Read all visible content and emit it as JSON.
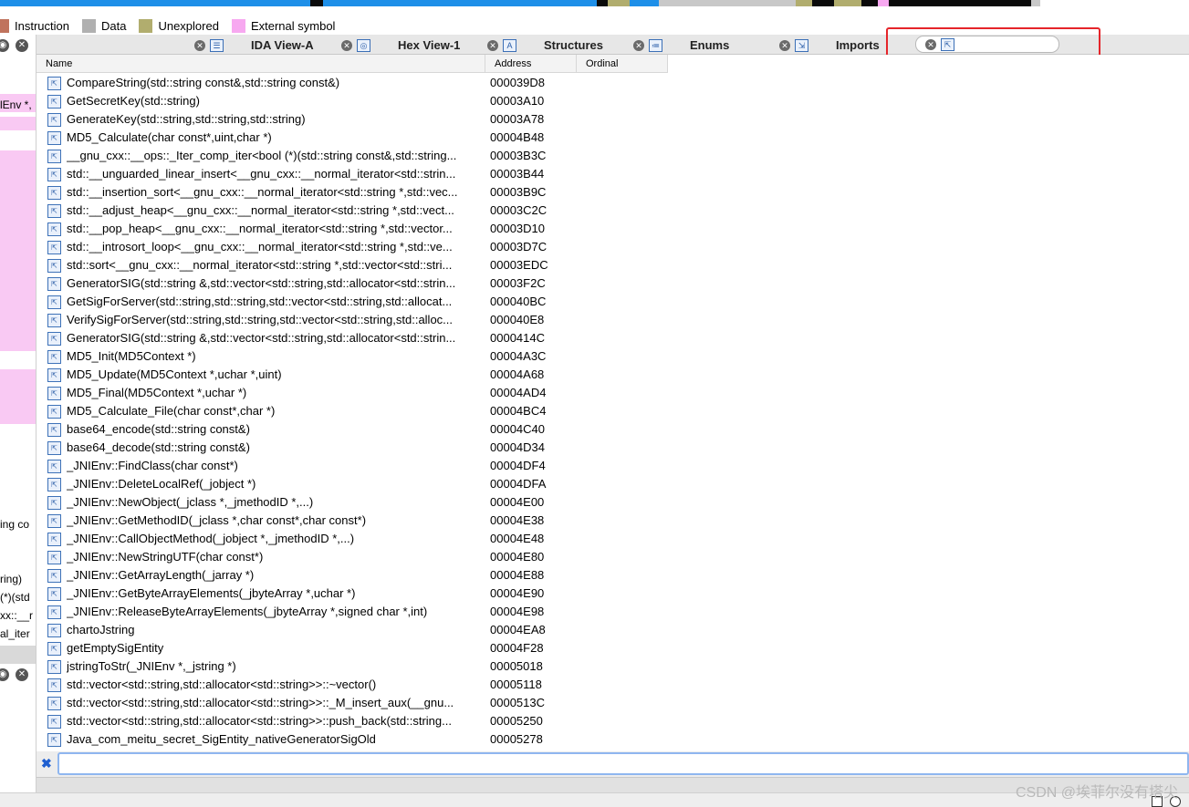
{
  "legend": [
    {
      "label": "Instruction",
      "color": "#c0735d"
    },
    {
      "label": "Data",
      "color": "#b0b0b0"
    },
    {
      "label": "Unexplored",
      "color": "#b1ad6e"
    },
    {
      "label": "External symbol",
      "color": "#f7a8f0"
    }
  ],
  "tabs": [
    {
      "label": "IDA View-A",
      "icon": "disassembly-icon"
    },
    {
      "label": "Hex View-1",
      "icon": "hex-view-icon"
    },
    {
      "label": "Structures",
      "icon": "structures-icon"
    },
    {
      "label": "Enums",
      "icon": "enums-icon"
    },
    {
      "label": "Imports",
      "icon": "imports-icon"
    },
    {
      "label": "",
      "icon": "exports-icon",
      "active": true
    }
  ],
  "table": {
    "columns": [
      "Name",
      "Address",
      "Ordinal"
    ],
    "rows": [
      {
        "name": "CompareString(std::string const&,std::string const&)",
        "address": "000039D8"
      },
      {
        "name": "GetSecretKey(std::string)",
        "address": "00003A10"
      },
      {
        "name": "GenerateKey(std::string,std::string,std::string)",
        "address": "00003A78"
      },
      {
        "name": "MD5_Calculate(char const*,uint,char *)",
        "address": "00004B48"
      },
      {
        "name": "__gnu_cxx::__ops::_Iter_comp_iter<bool (*)(std::string const&,std::string...",
        "address": "00003B3C"
      },
      {
        "name": "std::__unguarded_linear_insert<__gnu_cxx::__normal_iterator<std::strin...",
        "address": "00003B44"
      },
      {
        "name": "std::__insertion_sort<__gnu_cxx::__normal_iterator<std::string *,std::vec...",
        "address": "00003B9C"
      },
      {
        "name": "std::__adjust_heap<__gnu_cxx::__normal_iterator<std::string *,std::vect...",
        "address": "00003C2C"
      },
      {
        "name": "std::__pop_heap<__gnu_cxx::__normal_iterator<std::string *,std::vector...",
        "address": "00003D10"
      },
      {
        "name": "std::__introsort_loop<__gnu_cxx::__normal_iterator<std::string *,std::ve...",
        "address": "00003D7C"
      },
      {
        "name": "std::sort<__gnu_cxx::__normal_iterator<std::string *,std::vector<std::stri...",
        "address": "00003EDC"
      },
      {
        "name": "GeneratorSIG(std::string &,std::vector<std::string,std::allocator<std::strin...",
        "address": "00003F2C"
      },
      {
        "name": "GetSigForServer(std::string,std::string,std::vector<std::string,std::allocat...",
        "address": "000040BC"
      },
      {
        "name": "VerifySigForServer(std::string,std::string,std::vector<std::string,std::alloc...",
        "address": "000040E8"
      },
      {
        "name": "GeneratorSIG(std::string &,std::vector<std::string,std::allocator<std::strin...",
        "address": "0000414C"
      },
      {
        "name": "MD5_Init(MD5Context *)",
        "address": "00004A3C"
      },
      {
        "name": "MD5_Update(MD5Context *,uchar *,uint)",
        "address": "00004A68"
      },
      {
        "name": "MD5_Final(MD5Context *,uchar *)",
        "address": "00004AD4"
      },
      {
        "name": "MD5_Calculate_File(char const*,char *)",
        "address": "00004BC4"
      },
      {
        "name": "base64_encode(std::string const&)",
        "address": "00004C40"
      },
      {
        "name": "base64_decode(std::string const&)",
        "address": "00004D34"
      },
      {
        "name": "_JNIEnv::FindClass(char const*)",
        "address": "00004DF4"
      },
      {
        "name": "_JNIEnv::DeleteLocalRef(_jobject *)",
        "address": "00004DFA"
      },
      {
        "name": "_JNIEnv::NewObject(_jclass *,_jmethodID *,...)",
        "address": "00004E00"
      },
      {
        "name": "_JNIEnv::GetMethodID(_jclass *,char const*,char const*)",
        "address": "00004E38"
      },
      {
        "name": "_JNIEnv::CallObjectMethod(_jobject *,_jmethodID *,...)",
        "address": "00004E48"
      },
      {
        "name": "_JNIEnv::NewStringUTF(char const*)",
        "address": "00004E80"
      },
      {
        "name": "_JNIEnv::GetArrayLength(_jarray *)",
        "address": "00004E88"
      },
      {
        "name": "_JNIEnv::GetByteArrayElements(_jbyteArray *,uchar *)",
        "address": "00004E90"
      },
      {
        "name": "_JNIEnv::ReleaseByteArrayElements(_jbyteArray *,signed char *,int)",
        "address": "00004E98"
      },
      {
        "name": "chartoJstring",
        "address": "00004EA8"
      },
      {
        "name": "getEmptySigEntity",
        "address": "00004F28"
      },
      {
        "name": "jstringToStr(_JNIEnv *,_jstring *)",
        "address": "00005018"
      },
      {
        "name": "std::vector<std::string,std::allocator<std::string>>::~vector()",
        "address": "00005118"
      },
      {
        "name": "std::vector<std::string,std::allocator<std::string>>::_M_insert_aux(__gnu...",
        "address": "0000513C"
      },
      {
        "name": "std::vector<std::string,std::allocator<std::string>>::push_back(std::string...",
        "address": "00005250"
      },
      {
        "name": "Java_com_meitu_secret_SigEntity_nativeGeneratorSigOld",
        "address": "00005278"
      }
    ]
  },
  "left_panel": {
    "fragments": [
      "lEnv *,",
      "ing co",
      "ring)",
      "(*)(std",
      "xx::__r",
      "al_iter"
    ]
  },
  "filter": {
    "value": "",
    "icon": "close-filter-icon"
  },
  "watermark": "CSDN @埃菲尔没有塔尖"
}
